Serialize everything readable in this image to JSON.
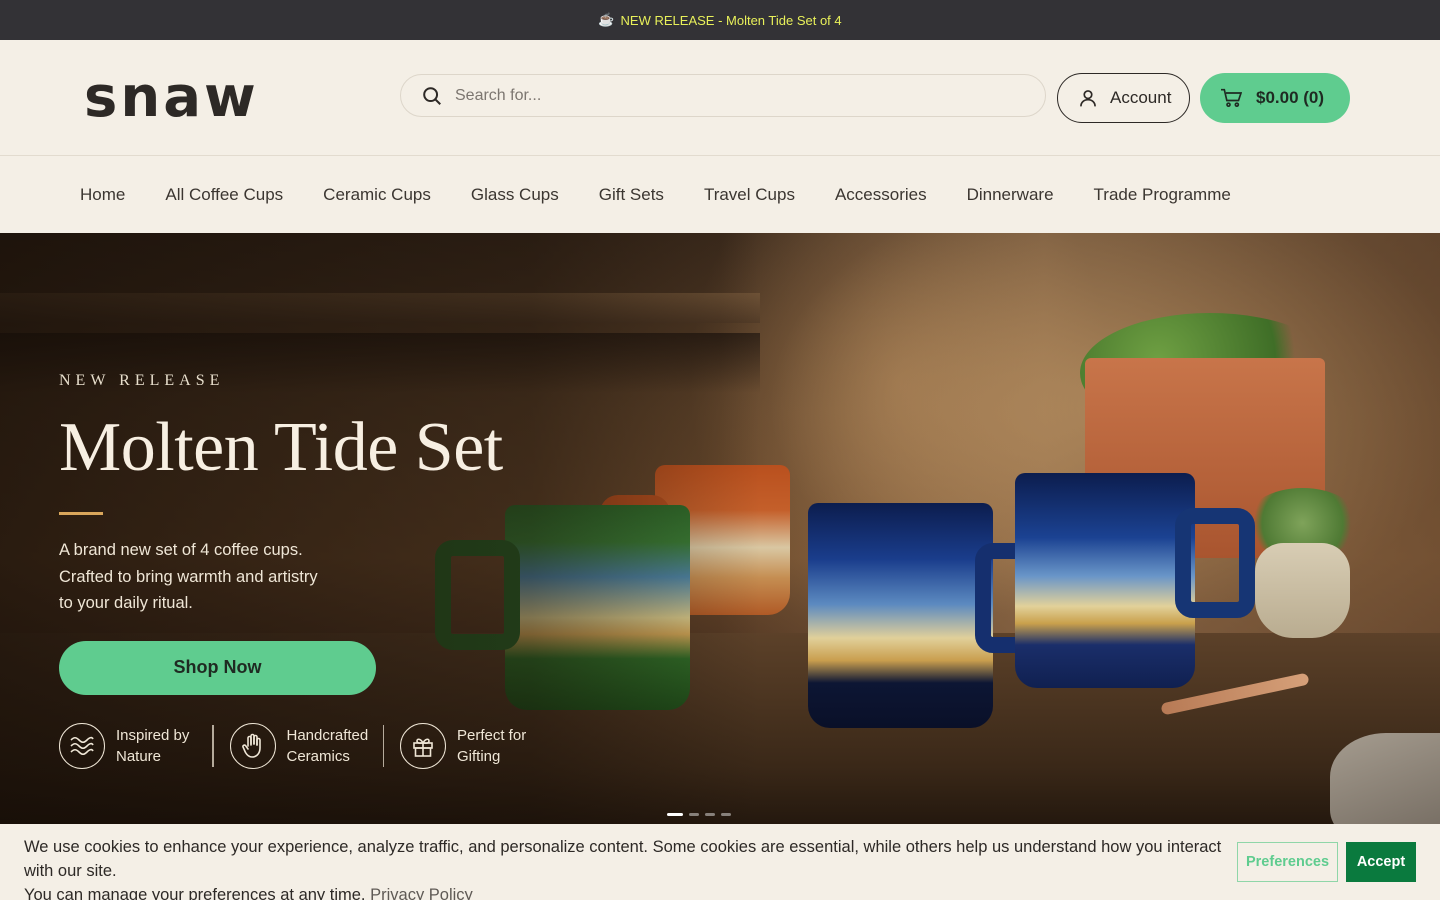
{
  "announcement": {
    "icon": "coffee-cup-icon",
    "text": "NEW RELEASE - Molten Tide Set of 4",
    "color": "#e8f05a"
  },
  "header": {
    "logo": "snaw",
    "search_placeholder": "Search for...",
    "account_label": "Account",
    "cart_label": "$0.00 (0)"
  },
  "nav": {
    "items": [
      "Home",
      "All Coffee Cups",
      "Ceramic Cups",
      "Glass Cups",
      "Gift Sets",
      "Travel Cups",
      "Accessories",
      "Dinnerware",
      "Trade Programme"
    ]
  },
  "hero": {
    "eyebrow": "NEW RELEASE",
    "title": "Molten Tide Set",
    "desc_line1": "A brand new set of 4 coffee cups.",
    "desc_line2": "Crafted to bring warmth and artistry",
    "desc_line3": "to your daily ritual.",
    "cta": "Shop Now",
    "features": [
      {
        "icon": "waves-icon",
        "line1": "Inspired by",
        "line2": "Nature"
      },
      {
        "icon": "hand-icon",
        "line1": "Handcrafted",
        "line2": "Ceramics"
      },
      {
        "icon": "gift-icon",
        "line1": "Perfect for",
        "line2": "Gifting"
      }
    ],
    "slides": 4,
    "active_slide": 1
  },
  "cookie": {
    "line1": "We use cookies to enhance your experience, analyze traffic, and personalize content. Some cookies are essential, while others help us understand how you interact with our site.",
    "line2": "You can manage your preferences at any time.",
    "policy_link": "Privacy Policy",
    "preferences_label": "Preferences",
    "accept_label": "Accept"
  },
  "colors": {
    "accent": "#5fcc8f",
    "accept": "#0a7a3e",
    "topbar": "#333236",
    "background": "#f4efe6"
  }
}
